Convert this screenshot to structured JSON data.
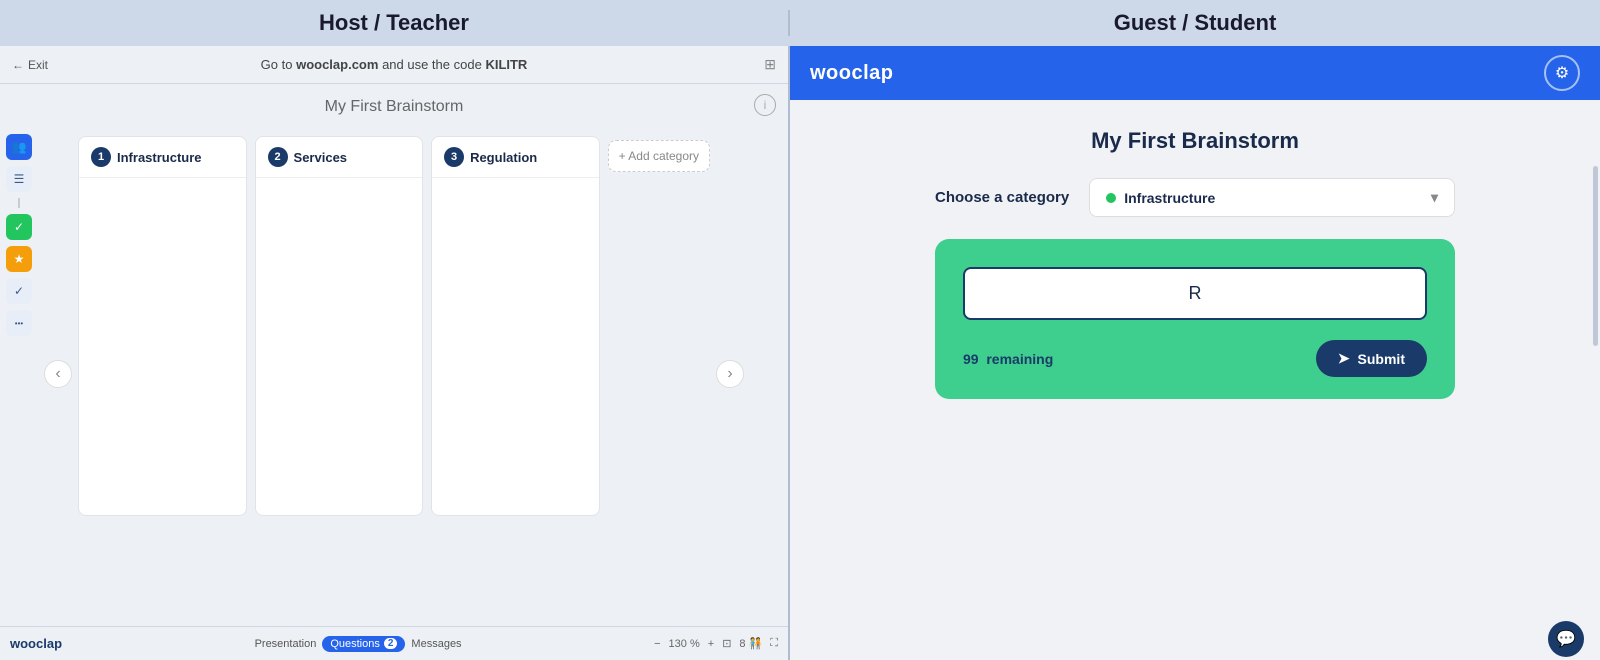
{
  "top_header": {
    "host_label": "Host / Teacher",
    "guest_label": "Guest / Student"
  },
  "host": {
    "exit_label": "Exit",
    "instruction_prefix": "Go to",
    "instruction_site": "wooclap.com",
    "instruction_middle": "and use the code",
    "instruction_code": "KILITR",
    "title": "My First Brainstorm",
    "nav_left": "‹",
    "nav_right": "›",
    "categories": [
      {
        "num": "1",
        "label": "Infrastructure"
      },
      {
        "num": "2",
        "label": "Services"
      },
      {
        "num": "3",
        "label": "Regulation"
      }
    ],
    "add_category_label": "+ Add category",
    "sidebar_icons": [
      "👥",
      "☰",
      "✓",
      "★",
      "✓",
      "•"
    ],
    "bottom_logo": "wooclap",
    "tabs": [
      {
        "label": "Presentation",
        "active": false
      },
      {
        "label": "Questions",
        "active": true,
        "badge": "2"
      },
      {
        "label": "Messages",
        "active": false
      }
    ],
    "zoom": "130 %",
    "page_num": "8",
    "info_icon": "i"
  },
  "guest": {
    "logo": "wooclap",
    "title": "My First Brainstorm",
    "category_label": "Choose a category",
    "selected_category": "Infrastructure",
    "input_value": "R",
    "input_placeholder": "",
    "remaining_label": "remaining",
    "remaining_count": "99",
    "submit_label": "Submit",
    "chat_icon": "💬"
  }
}
